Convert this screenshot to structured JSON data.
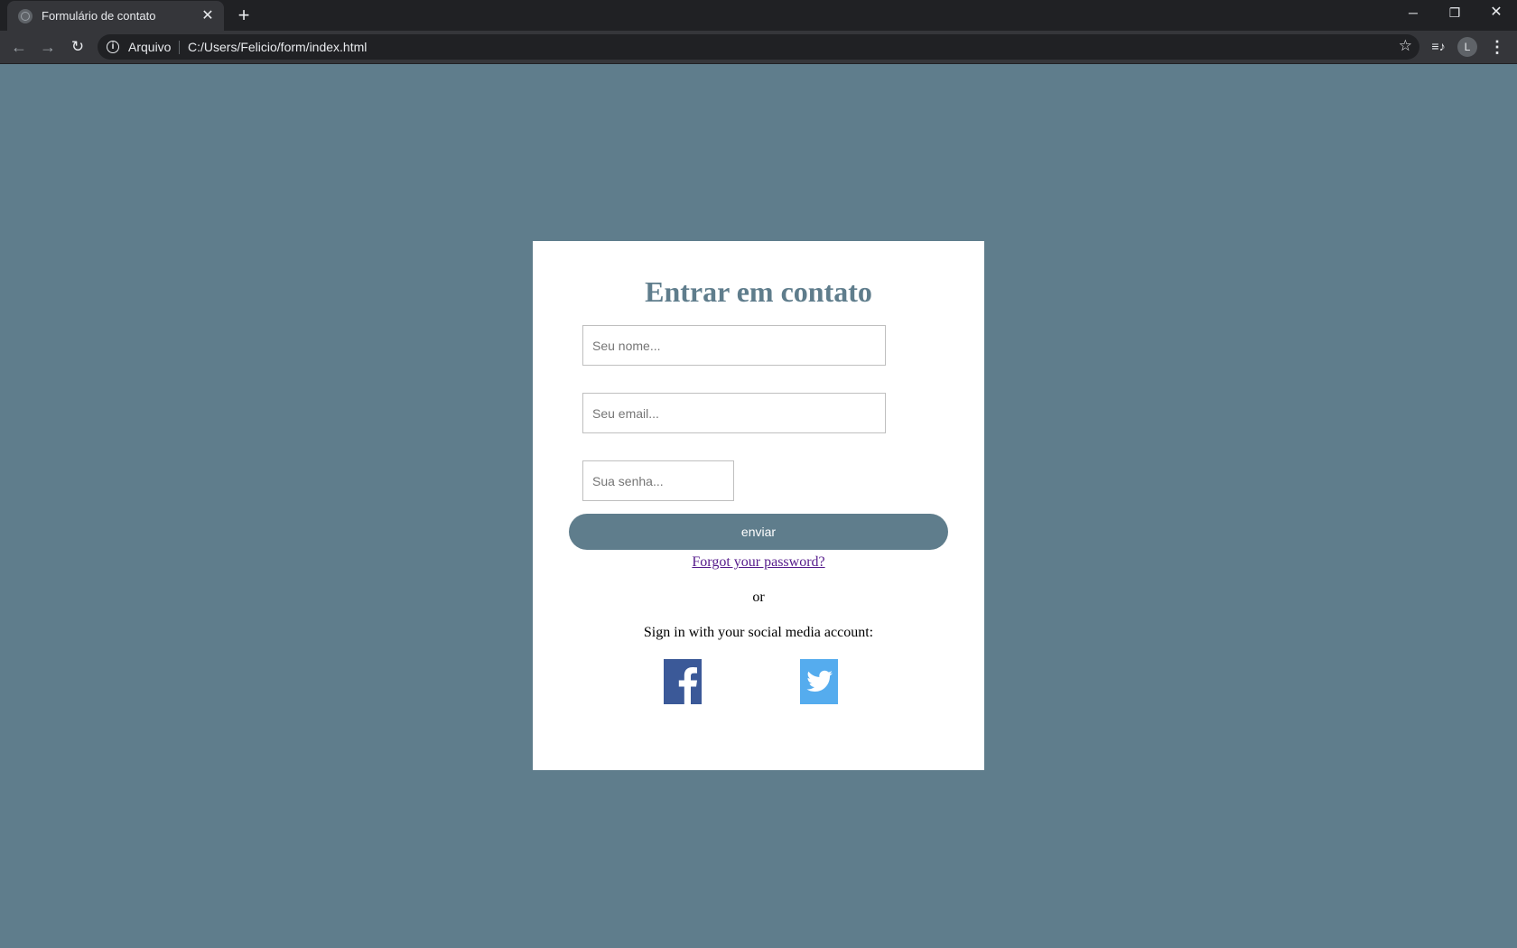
{
  "browser": {
    "tab_title": "Formulário de contato",
    "origin_label": "Arquivo",
    "url": "C:/Users/Felicio/form/index.html",
    "profile_initial": "L"
  },
  "icons": {
    "tab_favicon": "globe-icon",
    "tab_close": "close-icon",
    "new_tab": "plus-icon",
    "back": "arrow-left-icon",
    "forward": "arrow-right-icon",
    "reload": "reload-icon",
    "site_info": "info-icon",
    "bookmark": "star-icon",
    "media": "media-control-icon",
    "menu": "more-vert-icon",
    "facebook": "facebook-icon",
    "twitter": "twitter-icon"
  },
  "form": {
    "title": "Entrar em contato",
    "name_placeholder": "Seu nome...",
    "email_placeholder": "Seu email...",
    "password_placeholder": "Sua senha...",
    "submit_label": "enviar",
    "forgot_label": "Forgot your password?",
    "or_label": "or",
    "social_label": "Sign in with your social media account:"
  },
  "colors": {
    "page_background": "#5f7d8c",
    "accent": "#5f7d8c",
    "card_background": "#ffffff",
    "facebook": "#3b5998",
    "twitter": "#55acee",
    "link_visited": "#551a8b"
  }
}
